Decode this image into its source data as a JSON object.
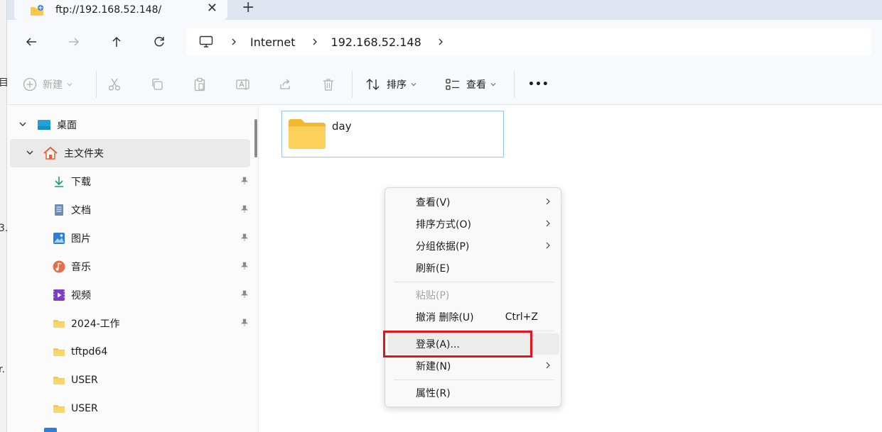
{
  "tab": {
    "title": "ftp://192.168.52.148/",
    "close": "✕",
    "new": "+"
  },
  "address": {
    "crumbs": [
      "Internet",
      "192.168.52.148"
    ]
  },
  "commands": {
    "new": "新建",
    "sort": "排序",
    "view": "查看",
    "more": "•••"
  },
  "sidebar": {
    "items": [
      {
        "label": "桌面"
      },
      {
        "label": "主文件夹"
      },
      {
        "label": "下载"
      },
      {
        "label": "文档"
      },
      {
        "label": "图片"
      },
      {
        "label": "音乐"
      },
      {
        "label": "视频"
      },
      {
        "label": "2024-工作"
      },
      {
        "label": "tftpd64"
      },
      {
        "label": "USER"
      },
      {
        "label": "USER"
      }
    ]
  },
  "content": {
    "folders": [
      {
        "name": "day"
      }
    ]
  },
  "context_menu": {
    "view": "查看(V)",
    "sort_by": "排序方式(O)",
    "group_by": "分组依据(P)",
    "refresh": "刷新(E)",
    "paste": "粘贴(P)",
    "undo": "撤消 删除(U)",
    "undo_shortcut": "Ctrl+Z",
    "login": "登录(A)...",
    "new": "新建(N)",
    "properties": "属性(R)"
  },
  "colors": {
    "accent": "#0067c0",
    "highlight_box": "#e3141e",
    "folder": "#f8c849"
  }
}
